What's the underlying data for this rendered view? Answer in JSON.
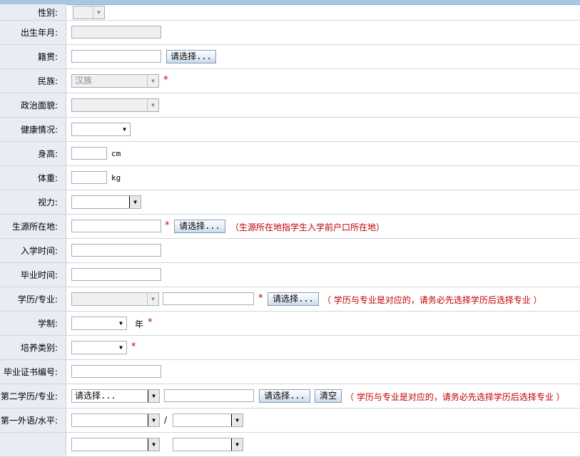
{
  "fields": {
    "gender": {
      "label": "性别:"
    },
    "birth_date": {
      "label": "出生年月:"
    },
    "native_place": {
      "label": "籍贯:",
      "button": "请选择..."
    },
    "ethnicity": {
      "label": "民族:",
      "value": "汉族",
      "required": "*"
    },
    "political_status": {
      "label": "政治面貌:"
    },
    "health": {
      "label": "健康情况:"
    },
    "height": {
      "label": "身高:",
      "unit": "cm"
    },
    "weight": {
      "label": "体重:",
      "unit": "kg"
    },
    "vision": {
      "label": "视力:"
    },
    "origin_location": {
      "label": "生源所在地:",
      "required": "*",
      "button": "请选择...",
      "hint": "（生源所在地指学生入学前户口所在地）"
    },
    "enroll_date": {
      "label": "入学时间:"
    },
    "grad_date": {
      "label": "毕业时间:"
    },
    "degree_major": {
      "label": "学历/专业:",
      "required": "*",
      "button": "请选择...",
      "hint": "（ 学历与专业是对应的，请务必先选择学历后选择专业 ）"
    },
    "program_length": {
      "label": "学制:",
      "unit": "年",
      "required": "*"
    },
    "training_type": {
      "label": "培养类别:",
      "required": "*"
    },
    "certificate_no": {
      "label": "毕业证书编号:"
    },
    "second_degree": {
      "label": "第二学历/专业:",
      "select_value": "请选择...",
      "button": "请选择...",
      "clear_button": "清空",
      "hint": "（ 学历与专业是对应的，请务必先选择学历后选择专业 ）"
    },
    "foreign_lang": {
      "label": "第一外语/水平:",
      "separator": "/"
    }
  }
}
